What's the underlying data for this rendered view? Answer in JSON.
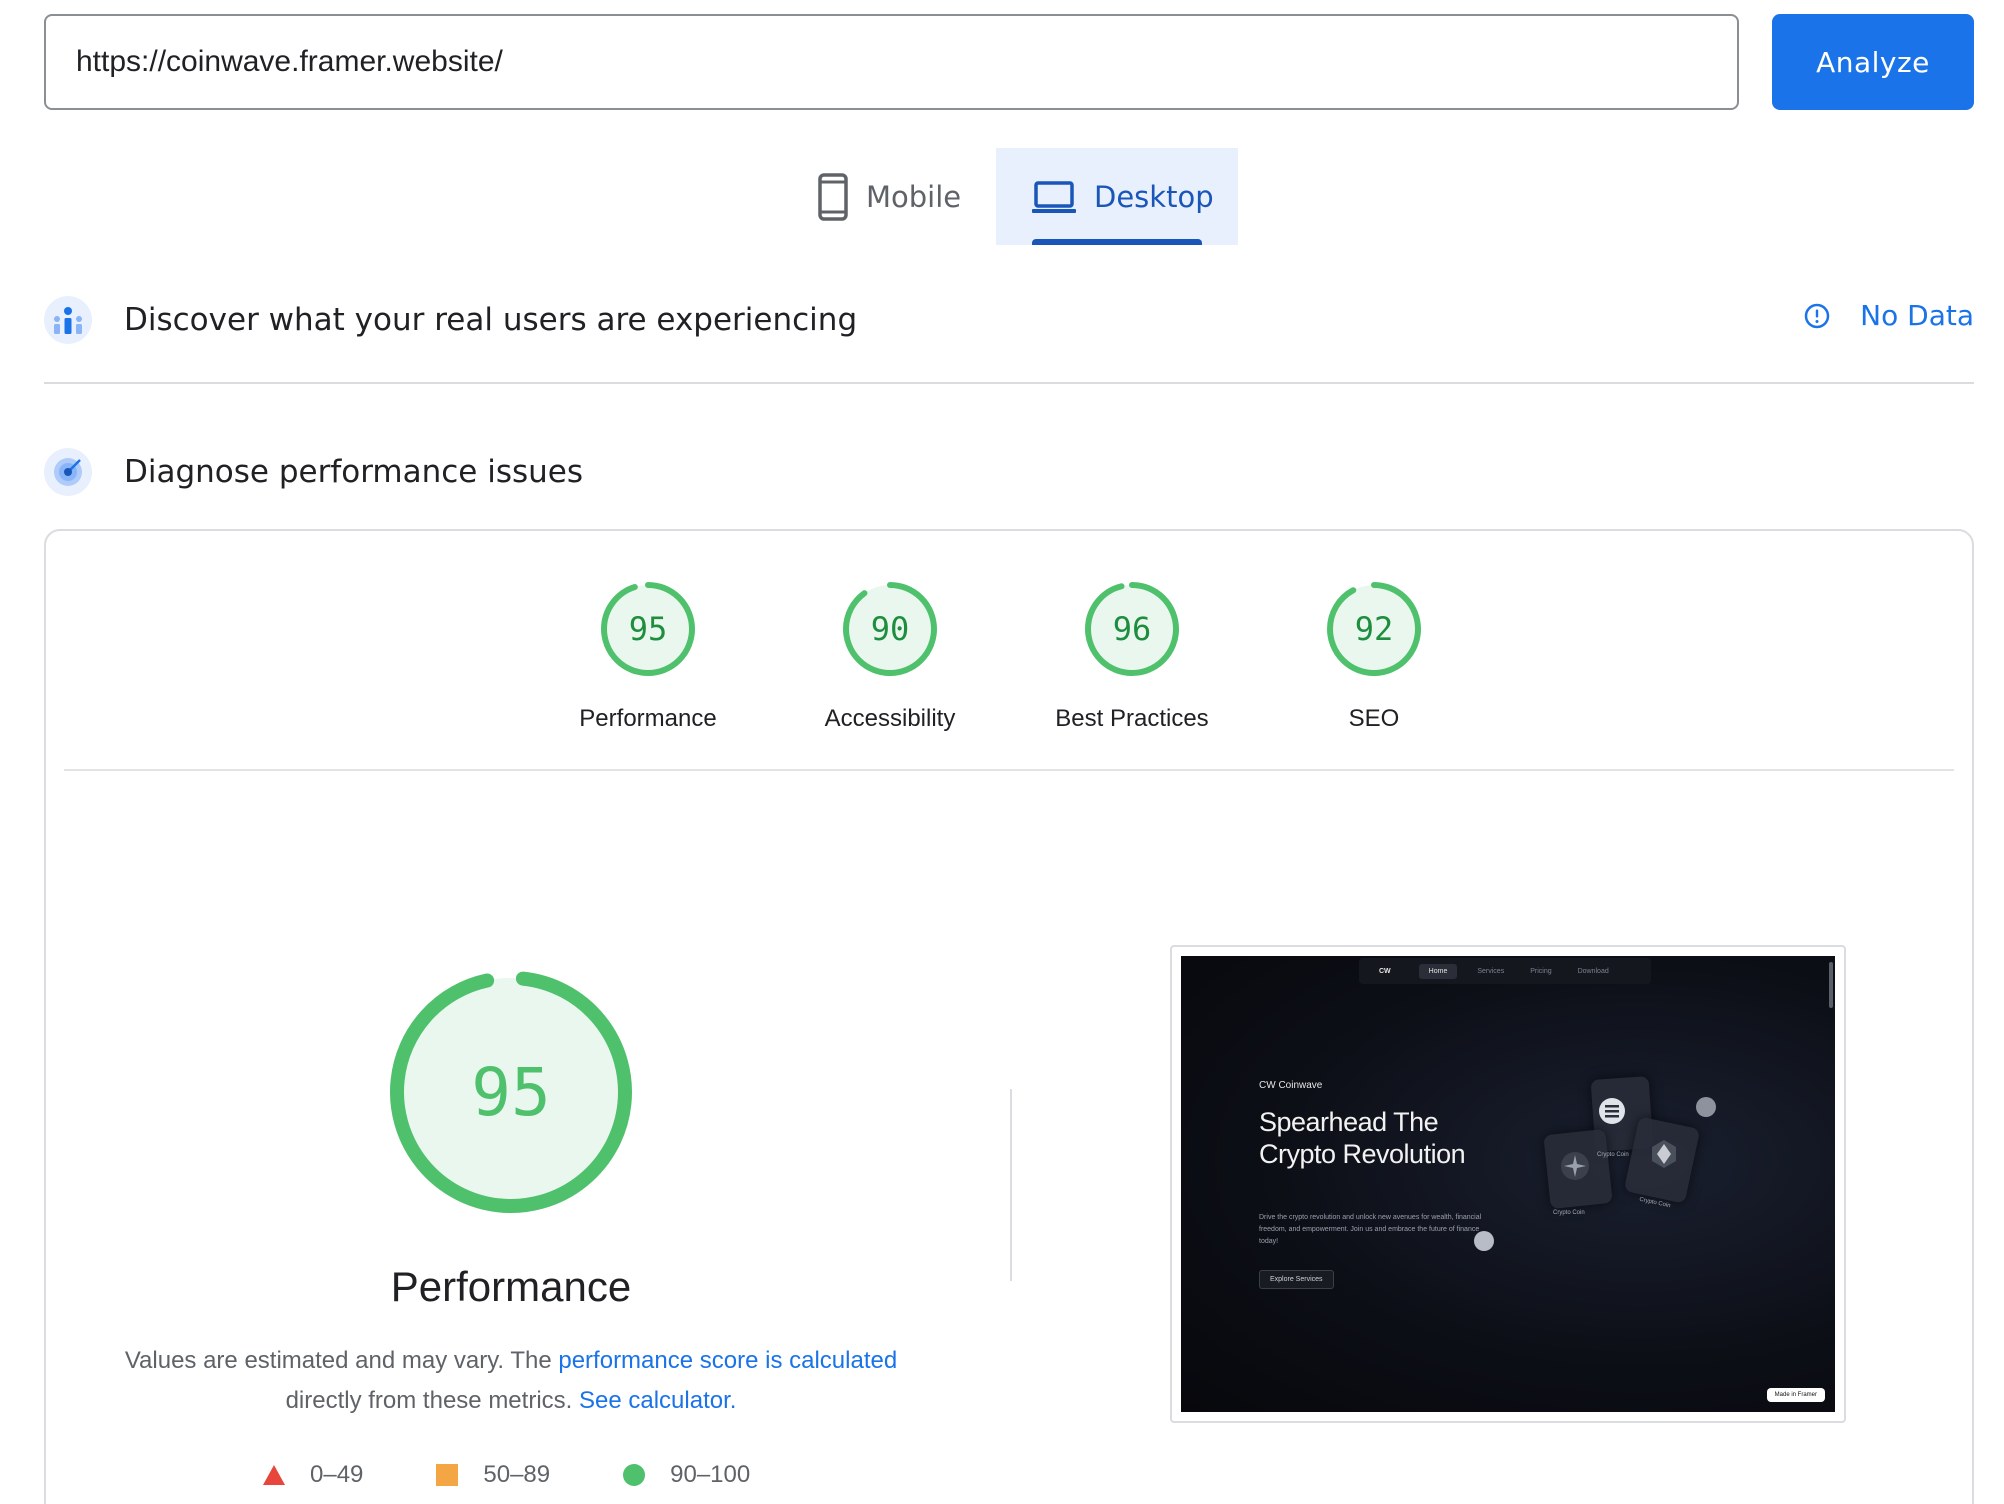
{
  "url_bar": {
    "value": "https://coinwave.framer.website/"
  },
  "analyze_button": {
    "label": "Analyze"
  },
  "device_tabs": {
    "mobile": {
      "label": "Mobile",
      "selected": false
    },
    "desktop": {
      "label": "Desktop",
      "selected": true
    }
  },
  "real_users": {
    "title": "Discover what your real users are experiencing",
    "status": "No Data"
  },
  "diagnose": {
    "title": "Diagnose performance issues"
  },
  "scores": [
    {
      "label": "Performance",
      "value": "95"
    },
    {
      "label": "Accessibility",
      "value": "90"
    },
    {
      "label": "Best Practices",
      "value": "96"
    },
    {
      "label": "SEO",
      "value": "92"
    }
  ],
  "performance_detail": {
    "score": "95",
    "title": "Performance",
    "note_prefix": "Values are estimated and may vary. The ",
    "note_link": "performance score is calculated",
    "note_middle": " directly from these metrics. ",
    "calculator_link": "See calculator."
  },
  "legend": [
    {
      "range": "0–49",
      "shape": "triangle",
      "color": "#e8453c"
    },
    {
      "range": "50–89",
      "shape": "square",
      "color": "#f4a645"
    },
    {
      "range": "90–100",
      "shape": "circle",
      "color": "#4fc16d"
    }
  ],
  "colors": {
    "accent": "#1a73e8",
    "pass": "#4fc16d",
    "pass_bg": "#eaf7ee",
    "pass_text": "#1e8e3e"
  },
  "preview": {
    "nav_items": [
      "CW",
      "Home",
      "Services",
      "Pricing",
      "Download"
    ],
    "brand": "CW Coinwave",
    "headline": "Spearhead The Crypto Revolution",
    "body": "Drive the crypto revolution and unlock new avenues for wealth, financial freedom, and empowerment. Join us and embrace the future of finance today!",
    "button": "Explore Services",
    "coin_labels": [
      "Crypto Coin",
      "Crypto Coin",
      "Crypto Coin"
    ],
    "badge": "Made in Framer"
  }
}
